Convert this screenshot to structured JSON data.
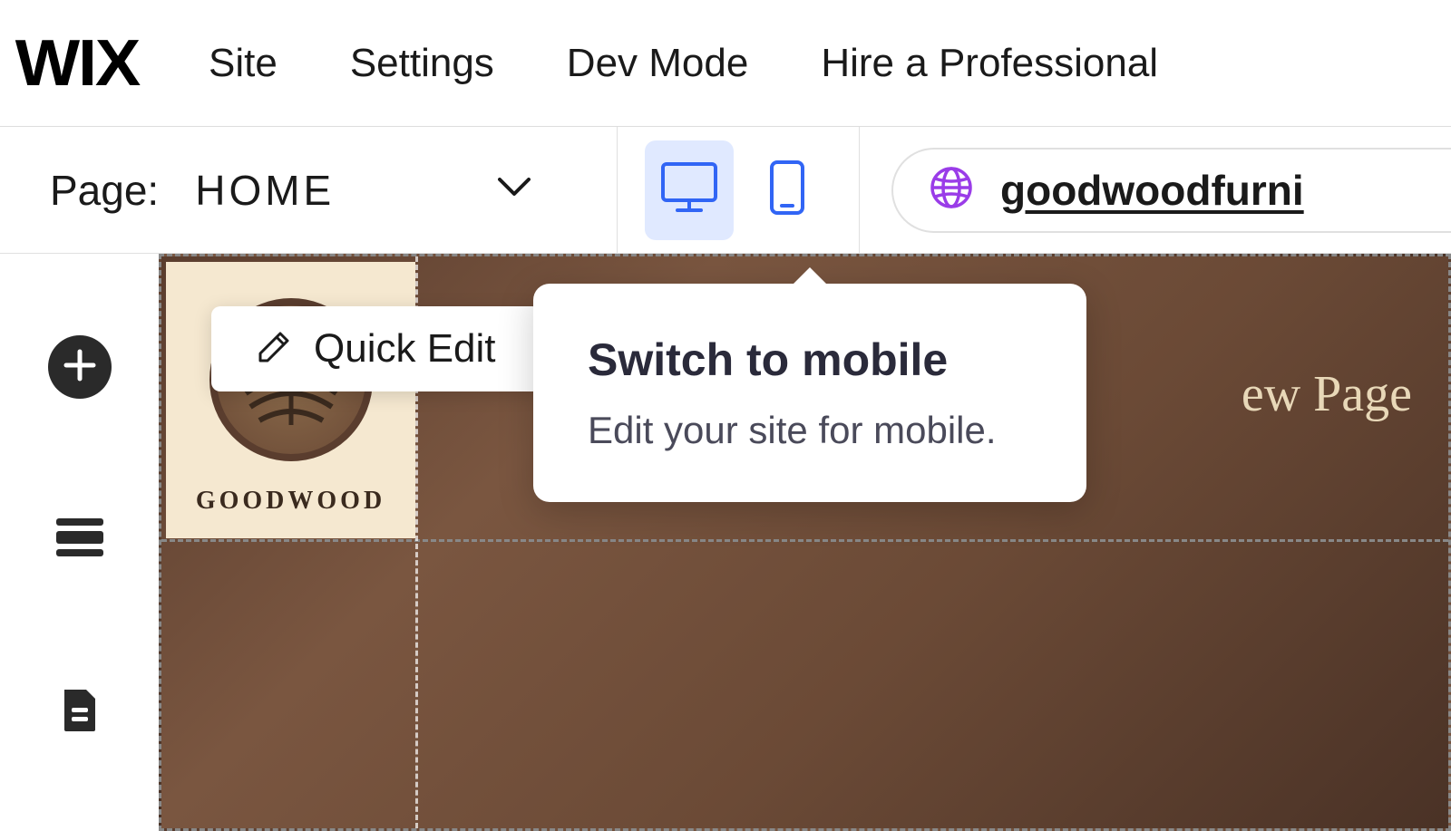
{
  "logo": "WIX",
  "topMenu": {
    "items": [
      "Site",
      "Settings",
      "Dev Mode",
      "Hire a Professional"
    ]
  },
  "pageBar": {
    "label": "Page:",
    "pageName": "HOME",
    "url": "goodwoodfurni"
  },
  "quickEdit": {
    "label": "Quick Edit"
  },
  "tooltip": {
    "title": "Switch to mobile",
    "description": "Edit your site for mobile."
  },
  "site": {
    "logoText": "GOODWOOD",
    "navItem": "ew Page"
  }
}
